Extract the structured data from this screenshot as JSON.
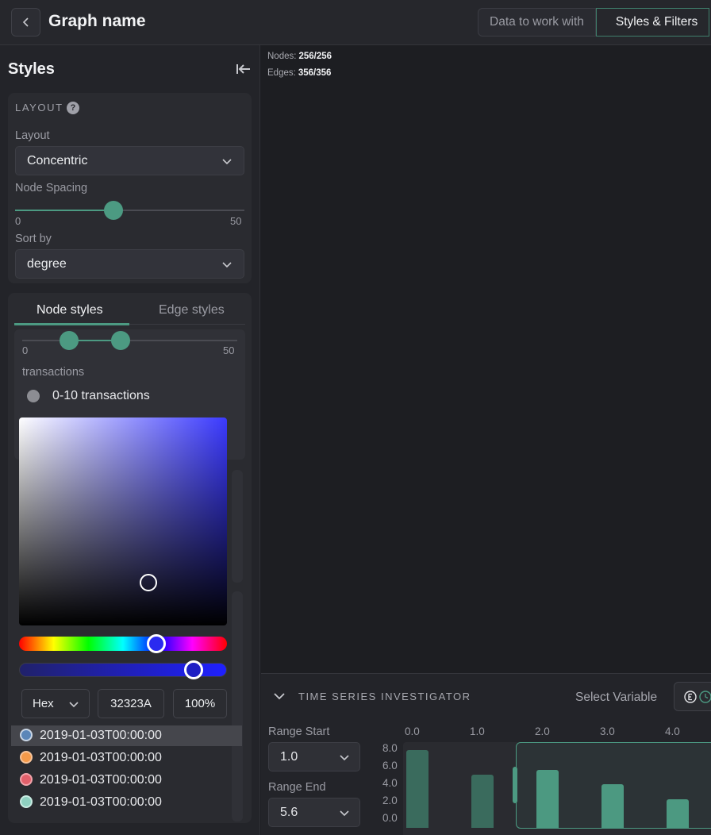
{
  "header": {
    "title": "Graph name",
    "tabs": [
      {
        "label": "Data to work with",
        "active": false
      },
      {
        "label": "Styles & Filters",
        "active": true
      }
    ]
  },
  "sidebar": {
    "title": "Styles",
    "layout_section": {
      "heading": "LAYOUT",
      "layout_label": "Layout",
      "layout_value": "Concentric",
      "spacing_label": "Node Spacing",
      "spacing_min": "0",
      "spacing_max": "50",
      "spacing_value_fraction": 0.43,
      "sort_label": "Sort by",
      "sort_value": "degree"
    },
    "style_tabs": [
      {
        "label": "Node styles",
        "active": true
      },
      {
        "label": "Edge styles",
        "active": false
      }
    ],
    "range": {
      "min": "0",
      "max": "50",
      "low_fraction": 0.21,
      "high_fraction": 0.46
    },
    "property_label": "transactions",
    "legend_item": "0-10 transactions",
    "color_picker": {
      "hue_fraction": 0.66,
      "alpha_fraction": 0.84,
      "format": "Hex",
      "hex": "32323A",
      "opacity": "100%"
    },
    "dates": [
      {
        "text": "2019-01-03T00:00:00",
        "color": "#5b86b8",
        "selected": true
      },
      {
        "text": "2019-01-03T00:00:00",
        "color": "#f59a4a",
        "selected": false
      },
      {
        "text": "2019-01-03T00:00:00",
        "color": "#e2606b",
        "selected": false
      },
      {
        "text": "2019-01-03T00:00:00",
        "color": "#8fd1c1",
        "selected": false
      }
    ]
  },
  "canvas": {
    "nodes_label": "Nodes:",
    "nodes_value": "256/256",
    "edges_label": "Edges:",
    "edges_value": "356/356"
  },
  "time_series": {
    "title": "TIME SERIES INVESTIGATOR",
    "select_variable": "Select Variable",
    "range_start_label": "Range Start",
    "range_start_value": "1.0",
    "range_end_label": "Range End",
    "range_end_value": "5.6",
    "chart_data": {
      "type": "bar",
      "x_ticks": [
        "0.0",
        "1.0",
        "2.0",
        "3.0",
        "4.0"
      ],
      "y_ticks": [
        "8.0",
        "6.0",
        "4.0",
        "2.0",
        "0.0"
      ],
      "x": [
        0.0,
        1.0,
        2.0,
        3.0,
        4.0
      ],
      "values": [
        8.9,
        6.1,
        6.6,
        5.0,
        3.3
      ],
      "ylim": [
        0,
        8.0
      ],
      "selected_range": [
        1.0,
        5.6
      ]
    }
  },
  "colors": {
    "accent": "#4c9a82",
    "background": "#1d1e22",
    "panel": "#232429"
  }
}
